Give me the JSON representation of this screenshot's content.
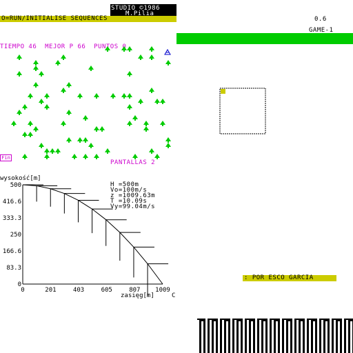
{
  "header": {
    "studio_line1": "STUDIO ©1986",
    "studio_line2": "M.Pilia",
    "run_instruction": "O=RUN/INITIALISE SEQUENCES",
    "version": "0.6",
    "game_label": "GAME-1"
  },
  "status": {
    "line": "TIEMPO 46  MEJOR P 66  PUNTOS 0",
    "pantallas": "PANTALLAS 2",
    "fin": "Fin"
  },
  "credit": ": POR ESCO GARCIA",
  "colors": {
    "tree": "#00cc00",
    "accent_yellow": "#cccc00",
    "accent_magenta": "#cc00cc",
    "player": "#0000cc"
  },
  "stats": {
    "h": "H =500m",
    "vo": "Vo=100m/s",
    "z": "z =1009.63m",
    "t": "T =10.09s",
    "vy": "Vy=99.04m/s"
  },
  "chart_data": {
    "type": "line",
    "ylabel": "wysokość[m]",
    "xlabel": "zasięg[m]",
    "xlabel_suffix": "C",
    "x_ticks": [
      0,
      201,
      403,
      605,
      807,
      1009
    ],
    "y_ticks": [
      0,
      83.3,
      166.6,
      250,
      333.3,
      416.6,
      500
    ],
    "y_tick_labels": [
      "0",
      "83.3",
      "166.6",
      "250",
      "333.3",
      "416.6",
      "500"
    ],
    "xlim": [
      0,
      1009
    ],
    "ylim": [
      0,
      500
    ],
    "series": [
      {
        "x": [
          0,
          100,
          200,
          300,
          400,
          500,
          600,
          700,
          800,
          900,
          1009
        ],
        "y": [
          500,
          495,
          480,
          456,
          422,
          378,
          324,
          260,
          186,
          102,
          0
        ]
      }
    ]
  },
  "icons": [
    "tree-icon",
    "player-skier-icon",
    "fin-icon"
  ]
}
